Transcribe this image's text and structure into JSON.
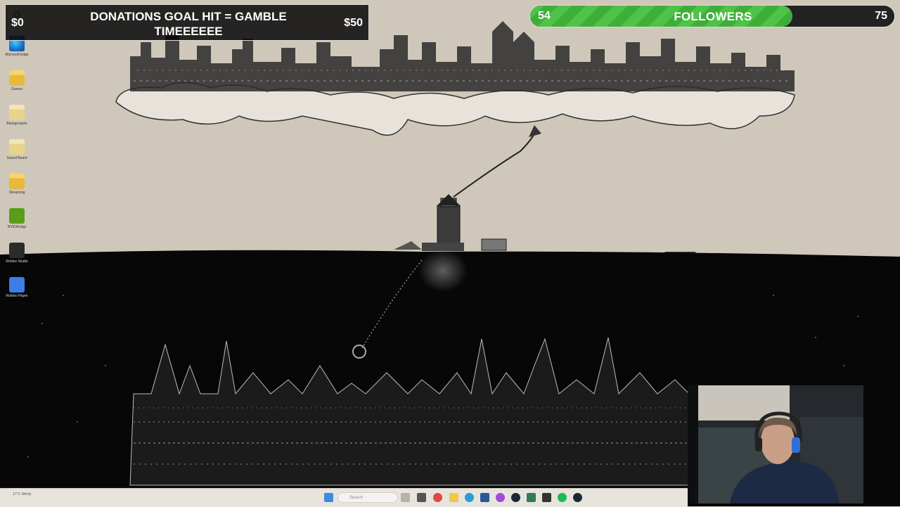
{
  "donation_goal": {
    "current": "$0",
    "goal": "$50",
    "title": "DONATIONS GOAL HIT = GAMBLE TIMEEEEEE",
    "progress_fraction": 0
  },
  "followers_goal": {
    "current": "54",
    "goal": "75",
    "label": "FOLLOWERS",
    "progress_fraction": 0.72
  },
  "desktop_icons": [
    {
      "label": "",
      "icon": "recycle-bin-icon"
    },
    {
      "label": "Microsoft Edge",
      "icon": "edge-icon"
    },
    {
      "label": "Games",
      "icon": "folder-icon"
    },
    {
      "label": "Backgrounds",
      "icon": "folder-icon"
    },
    {
      "label": "Sound Board",
      "icon": "folder-icon"
    },
    {
      "label": "Streaming",
      "icon": "folder-icon"
    },
    {
      "label": "NVIDIA App",
      "icon": "nvidia-icon"
    },
    {
      "label": "Roblox Studio",
      "icon": "roblox-studio-icon"
    },
    {
      "label": "Roblox Player",
      "icon": "roblox-player-icon"
    }
  ],
  "taskbar": {
    "weather": "17°C Windy",
    "search_placeholder": "Search",
    "icons": [
      "start-icon",
      "search-icon",
      "widgets-icon",
      "task-view-icon",
      "chrome-icon",
      "file-explorer-icon",
      "edge-icon",
      "word-icon",
      "messenger-icon",
      "steam-icon",
      "app-icon",
      "obs-icon",
      "spotify-icon",
      "steam-icon"
    ]
  },
  "colors": {
    "follower_bar": "#4fc248",
    "donation_bg": "#000000",
    "sky": "#cfc8ba",
    "ocean": "#070707"
  }
}
